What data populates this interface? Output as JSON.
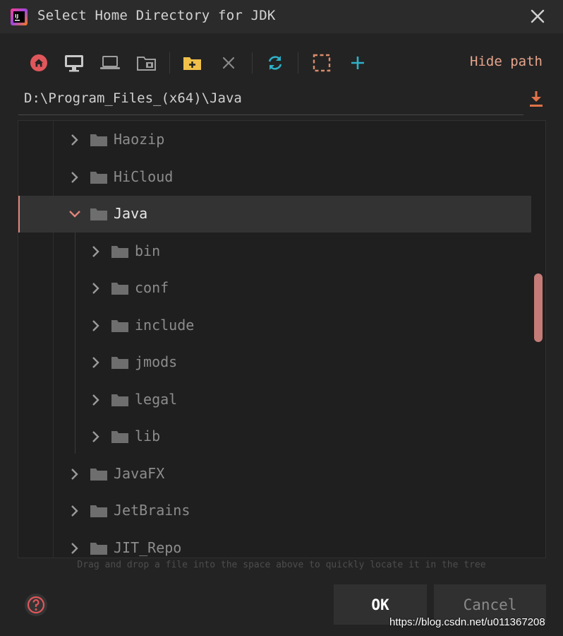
{
  "window": {
    "title": "Select Home Directory for JDK",
    "icon": "intellij-icon",
    "close_icon": "close-icon"
  },
  "toolbar": {
    "buttons": [
      {
        "name": "home-icon",
        "color": "#e0575b"
      },
      {
        "name": "desktop-icon",
        "color": "#bbbbbb"
      },
      {
        "name": "laptop-icon",
        "color": "#bbbbbb"
      },
      {
        "name": "module-folder-icon",
        "color": "#bbbbbb"
      },
      {
        "name": "new-folder-icon",
        "color": "#f0c04a"
      },
      {
        "name": "delete-icon",
        "color": "#8a8a8a"
      },
      {
        "name": "refresh-icon",
        "color": "#2eb0c8"
      },
      {
        "name": "select-area-icon",
        "color": "#d98b6a"
      },
      {
        "name": "add-icon",
        "color": "#2eb0c8"
      }
    ],
    "hide_path_label": "Hide path"
  },
  "path": {
    "value": "D:\\Program_Files_(x64)\\Java",
    "download_icon": "download-icon"
  },
  "tree": {
    "items": [
      {
        "label": "Haozip",
        "expanded": false,
        "level": 0
      },
      {
        "label": "HiCloud",
        "expanded": false,
        "level": 0
      },
      {
        "label": "Java",
        "expanded": true,
        "level": 0,
        "selected": true
      },
      {
        "label": "bin",
        "expanded": false,
        "level": 1
      },
      {
        "label": "conf",
        "expanded": false,
        "level": 1
      },
      {
        "label": "include",
        "expanded": false,
        "level": 1
      },
      {
        "label": "jmods",
        "expanded": false,
        "level": 1
      },
      {
        "label": "legal",
        "expanded": false,
        "level": 1
      },
      {
        "label": "lib",
        "expanded": false,
        "level": 1
      },
      {
        "label": "JavaFX",
        "expanded": false,
        "level": 0
      },
      {
        "label": "JetBrains",
        "expanded": false,
        "level": 0
      },
      {
        "label": "JIT_Repo",
        "expanded": false,
        "level": 0
      }
    ]
  },
  "hint": "Drag and drop a file into the space above to quickly locate it in the tree",
  "footer": {
    "ok_label": "OK",
    "cancel_label": "Cancel",
    "help_icon": "help-icon"
  },
  "watermark": "https://blog.csdn.net/u011367208",
  "colors": {
    "accent": "#e0857a",
    "scrollbar": "#c57b78",
    "background": "#232323"
  }
}
